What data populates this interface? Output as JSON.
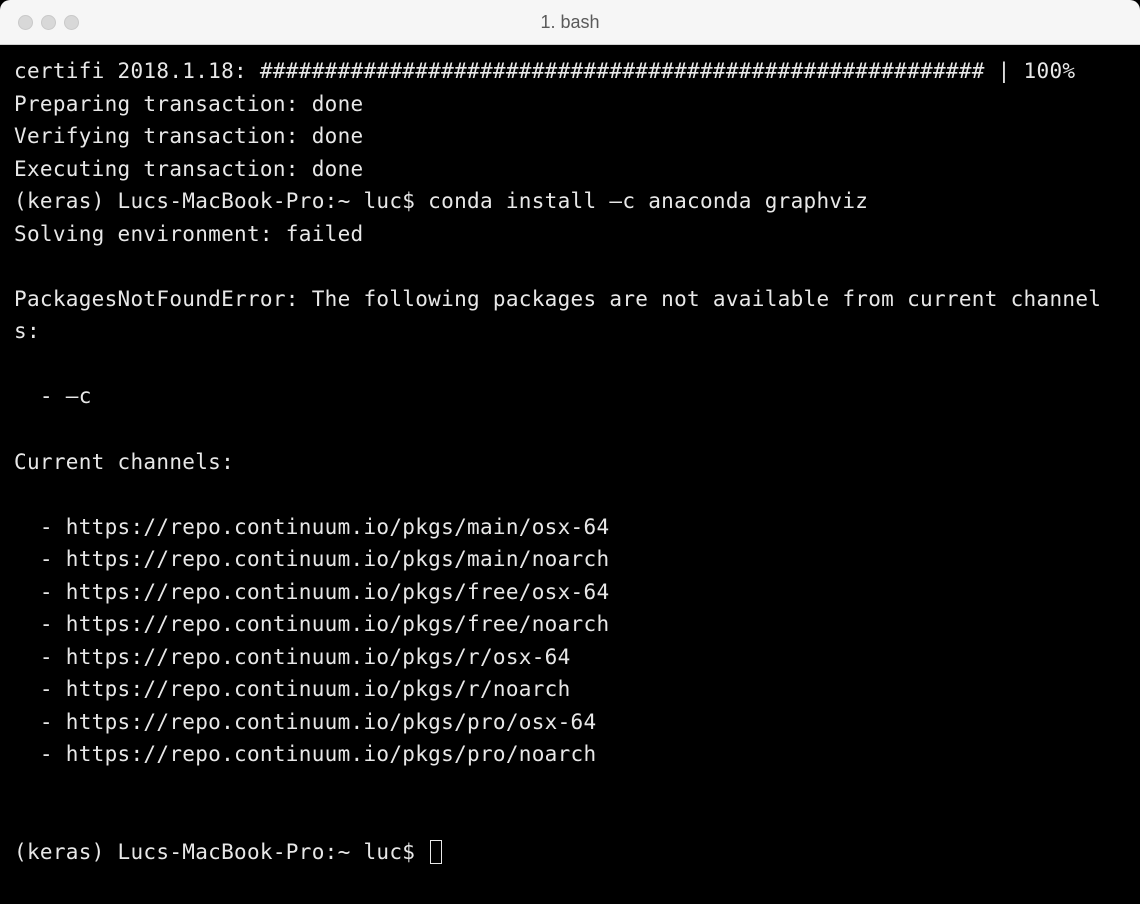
{
  "window": {
    "title": "1. bash"
  },
  "terminal": {
    "lines": {
      "l0": "certifi 2018.1.18: ######################################################## | 100%",
      "l1": "Preparing transaction: done",
      "l2": "Verifying transaction: done",
      "l3": "Executing transaction: done",
      "l4": "(keras) Lucs-MacBook-Pro:~ luc$ conda install –c anaconda graphviz",
      "l5": "Solving environment: failed",
      "l6": "",
      "l7": "PackagesNotFoundError: The following packages are not available from current channels:",
      "l8": "",
      "l9": "  - –c",
      "l10": "",
      "l11": "Current channels:",
      "l12": "",
      "l13": "  - https://repo.continuum.io/pkgs/main/osx-64",
      "l14": "  - https://repo.continuum.io/pkgs/main/noarch",
      "l15": "  - https://repo.continuum.io/pkgs/free/osx-64",
      "l16": "  - https://repo.continuum.io/pkgs/free/noarch",
      "l17": "  - https://repo.continuum.io/pkgs/r/osx-64",
      "l18": "  - https://repo.continuum.io/pkgs/r/noarch",
      "l19": "  - https://repo.continuum.io/pkgs/pro/osx-64",
      "l20": "  - https://repo.continuum.io/pkgs/pro/noarch",
      "l21": "",
      "l22": "",
      "prompt": "(keras) Lucs-MacBook-Pro:~ luc$ "
    }
  }
}
